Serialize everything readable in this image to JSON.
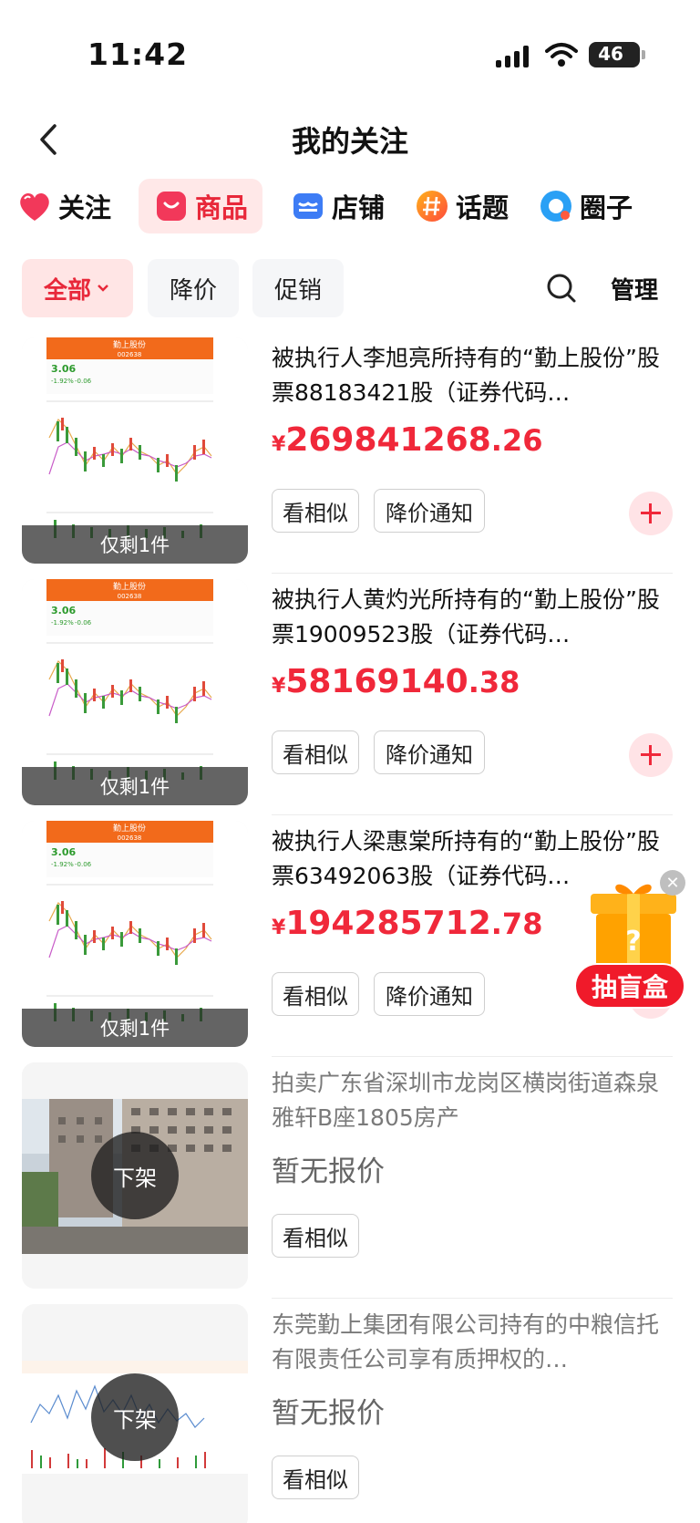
{
  "status_bar": {
    "time": "11:42",
    "battery": "46"
  },
  "nav": {
    "title": "我的关注"
  },
  "category_tabs": [
    {
      "label": "关注",
      "icon": "heart-icon",
      "active": false
    },
    {
      "label": "商品",
      "icon": "shopping-bag-icon",
      "active": true
    },
    {
      "label": "店铺",
      "icon": "store-icon",
      "active": false
    },
    {
      "label": "话题",
      "icon": "hashtag-icon",
      "active": false
    },
    {
      "label": "圈子",
      "icon": "circle-icon",
      "active": false
    }
  ],
  "filters": {
    "all": "全部",
    "price_drop": "降价",
    "promo": "促销",
    "manage": "管理"
  },
  "items": [
    {
      "title": "被执行人李旭亮所持有的“勤上股份”股票88183421股（证券代码…",
      "price_yen": "¥",
      "price_int": "269841268",
      "price_dec": ".26",
      "stock": "仅剩1件",
      "btn_similar": "看相似",
      "btn_notify": "降价通知"
    },
    {
      "title": "被执行人黄灼光所持有的“勤上股份”股票19009523股（证券代码…",
      "price_yen": "¥",
      "price_int": "58169140",
      "price_dec": ".38",
      "stock": "仅剩1件",
      "btn_similar": "看相似",
      "btn_notify": "降价通知"
    },
    {
      "title": "被执行人梁惠棠所持有的“勤上股份”股票63492063股（证券代码…",
      "price_yen": "¥",
      "price_int": "194285712",
      "price_dec": ".78",
      "stock": "仅剩1件",
      "btn_similar": "看相似",
      "btn_notify": "降价通知"
    },
    {
      "title": "拍卖广东省深圳市龙岗区横岗街道森泉雅轩B座1805房产",
      "no_price": "暂无报价",
      "status": "下架",
      "btn_similar": "看相似"
    },
    {
      "title": "东莞勤上集团有限公司持有的中粮信托有限责任公司享有质押权的…",
      "no_price": "暂无报价",
      "status": "下架",
      "btn_similar": "看相似"
    }
  ],
  "thumb_stock": {
    "name": "勤上股份",
    "code": "002638",
    "price": "3.06",
    "change_pct": "-1.92%",
    "change": "-0.06"
  },
  "blind_box": {
    "label": "抽盲盒"
  },
  "colors": {
    "accent": "#f0283a",
    "active_bg": "#ffe8e8"
  }
}
